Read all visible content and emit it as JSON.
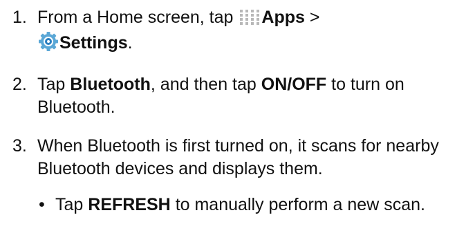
{
  "steps": [
    {
      "number": "1.",
      "line1_prefix": "From a Home screen, tap",
      "apps_label": "Apps",
      "separator": ">",
      "settings_label": "Settings",
      "trailing": "."
    },
    {
      "number": "2.",
      "tap": "Tap",
      "bluetooth_label": "Bluetooth",
      "middle": ", and then tap",
      "onoff_label": "ON/OFF",
      "suffix": "to turn on Bluetooth."
    },
    {
      "number": "3.",
      "text": "When Bluetooth is first turned on, it scans for nearby Bluetooth devices and displays them."
    }
  ],
  "bullet": {
    "glyph": "•",
    "tap": "Tap",
    "refresh_label": "REFRESH",
    "suffix": "to manually perform a new scan."
  },
  "icons": {
    "apps": "apps-grid-icon",
    "settings": "settings-gear-icon"
  },
  "colors": {
    "text": "#111111",
    "apps_icon": "#b8b8b8",
    "settings_outer": "#5aa7d6",
    "settings_inner": "#2b7fc0"
  }
}
